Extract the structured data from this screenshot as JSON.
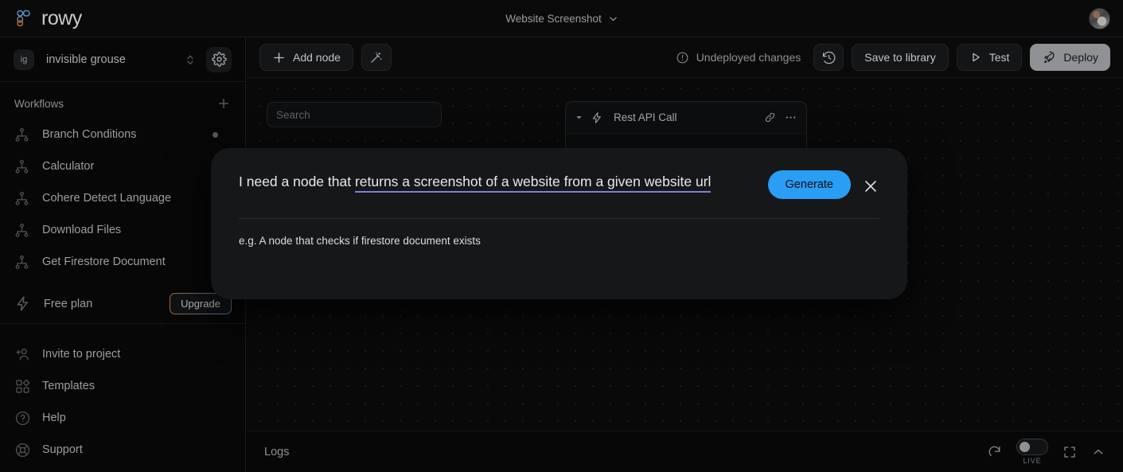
{
  "header": {
    "logo_text": "rowy",
    "logo_mark_icon": "rowy-logo-icon",
    "doc_title": "Website Screenshot",
    "doc_title_chevron_icon": "chevron-down-icon",
    "avatar_icon": "user-avatar"
  },
  "sidebar": {
    "project": {
      "badge": "ig",
      "name": "invisible grouse",
      "sort_icon": "sort-chevrons-icon",
      "settings_icon": "gear-icon"
    },
    "workflows_section": {
      "label": "Workflows",
      "add_icon": "plus-icon"
    },
    "workflows": [
      {
        "label": "Branch Conditions",
        "icon": "hierarchy-icon",
        "has_dot": true
      },
      {
        "label": "Calculator",
        "icon": "hierarchy-icon",
        "has_dot": false
      },
      {
        "label": "Cohere Detect Language",
        "icon": "hierarchy-icon",
        "has_dot": false
      },
      {
        "label": "Download Files",
        "icon": "hierarchy-icon",
        "has_dot": false
      },
      {
        "label": "Get Firestore Document",
        "icon": "hierarchy-icon",
        "has_dot": false
      }
    ],
    "plan": {
      "label": "Free plan",
      "icon": "lightning-bolt-icon",
      "upgrade_label": "Upgrade"
    },
    "bottom_nav": [
      {
        "label": "Invite to project",
        "icon": "person-add-icon"
      },
      {
        "label": "Templates",
        "icon": "templates-grid-icon"
      },
      {
        "label": "Help",
        "icon": "question-circle-icon"
      },
      {
        "label": "Support",
        "icon": "lifebuoy-icon"
      }
    ]
  },
  "toolbar": {
    "add_node_label": "Add node",
    "add_node_icon": "plus-icon",
    "magic_icon": "magic-wand-icon",
    "undeployed_label": "Undeployed changes",
    "undeployed_icon": "alert-circle-icon",
    "history_icon": "history-clock-icon",
    "save_library_label": "Save to library",
    "test_label": "Test",
    "test_icon": "play-triangle-icon",
    "deploy_label": "Deploy",
    "deploy_icon": "rocket-icon"
  },
  "canvas": {
    "search_placeholder": "Search",
    "search_value": "",
    "node": {
      "title": "Rest API Call",
      "collapse_icon": "caret-down-icon",
      "type_icon": "lightning-bolt-icon",
      "link_icon": "link-chain-icon",
      "more_icon": "more-horizontal-icon"
    }
  },
  "logs": {
    "label": "Logs",
    "refresh_icon": "refresh-icon",
    "live_label": "LIVE",
    "live_on": false,
    "fullscreen_icon": "fullscreen-icon",
    "collapse_icon": "chevron-up-icon"
  },
  "dialog": {
    "prompt_static": "I need a node that ",
    "prompt_editable": "returns a screenshot of a website from a given website url",
    "generate_label": "Generate",
    "close_icon": "close-x-icon",
    "hint": "e.g. A node that checks if firestore document exists"
  },
  "colors": {
    "accent_blue": "#2a9df4",
    "underline_purple": "#7b7fe0",
    "deploy_bg": "#8f9194",
    "page_bg": "#09090a",
    "dialog_bg": "#161719"
  }
}
